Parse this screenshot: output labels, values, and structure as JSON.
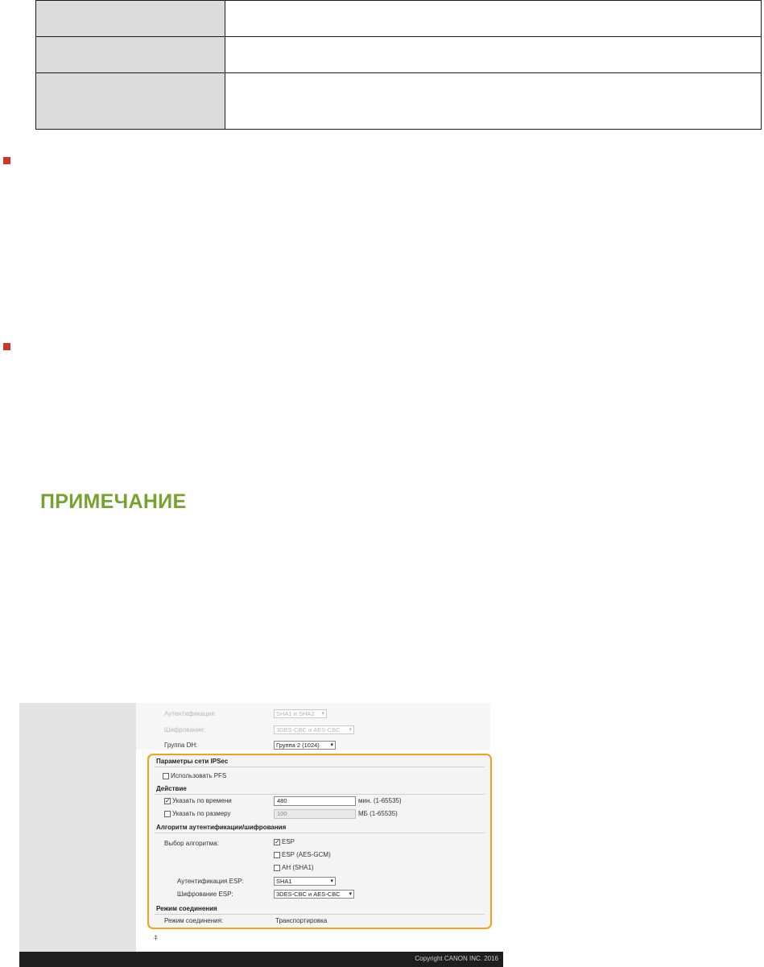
{
  "note_title": "ПРИМЕЧАНИЕ",
  "screenshot": {
    "ike_auth_label": "Аутентификация:",
    "ike_auth_value": "SHA1 и SHA2",
    "ike_enc_label": "Шифрование:",
    "ike_enc_value": "3DES-CBC и AES-CBC",
    "dh_label": "Группа DH:",
    "dh_value": "Группа 2 (1024)",
    "ipsec_header": "Параметры сети IPSec",
    "pfs_label": "Использовать PFS",
    "validity_header": "Действие",
    "by_time_label": "Указать по времени",
    "by_time_value": "480",
    "by_time_unit": "мин. (1-65535)",
    "by_size_label": "Указать по размеру",
    "by_size_value": "100",
    "by_size_unit": "МБ (1-65535)",
    "algo_header": "Алгоритм аутентификации/шифрования",
    "algo_select_label": "Выбор алгоритма:",
    "esp_label": "ESP",
    "esp_gcm_label": "ESP (AES-GCM)",
    "ah_label": "AH (SHA1)",
    "esp_auth_label": "Аутентификация ESP:",
    "esp_auth_value": "SHA1",
    "esp_enc_label": "Шифрование ESP:",
    "esp_enc_value": "3DES-CBC и AES-CBC",
    "conn_header": "Режим соединения",
    "conn_mode_label": "Режим соединения:",
    "conn_mode_value": "Транспортировка",
    "scroll_top_icon": "⍏",
    "copyright": "Copyright CANON INC. 2016",
    "check_mark": "✓",
    "dropdown_arrow": "▾"
  },
  "colors": {
    "bullet": "#c8382b",
    "note_title": "#78a22f",
    "highlight_border": "#f0a21e"
  }
}
